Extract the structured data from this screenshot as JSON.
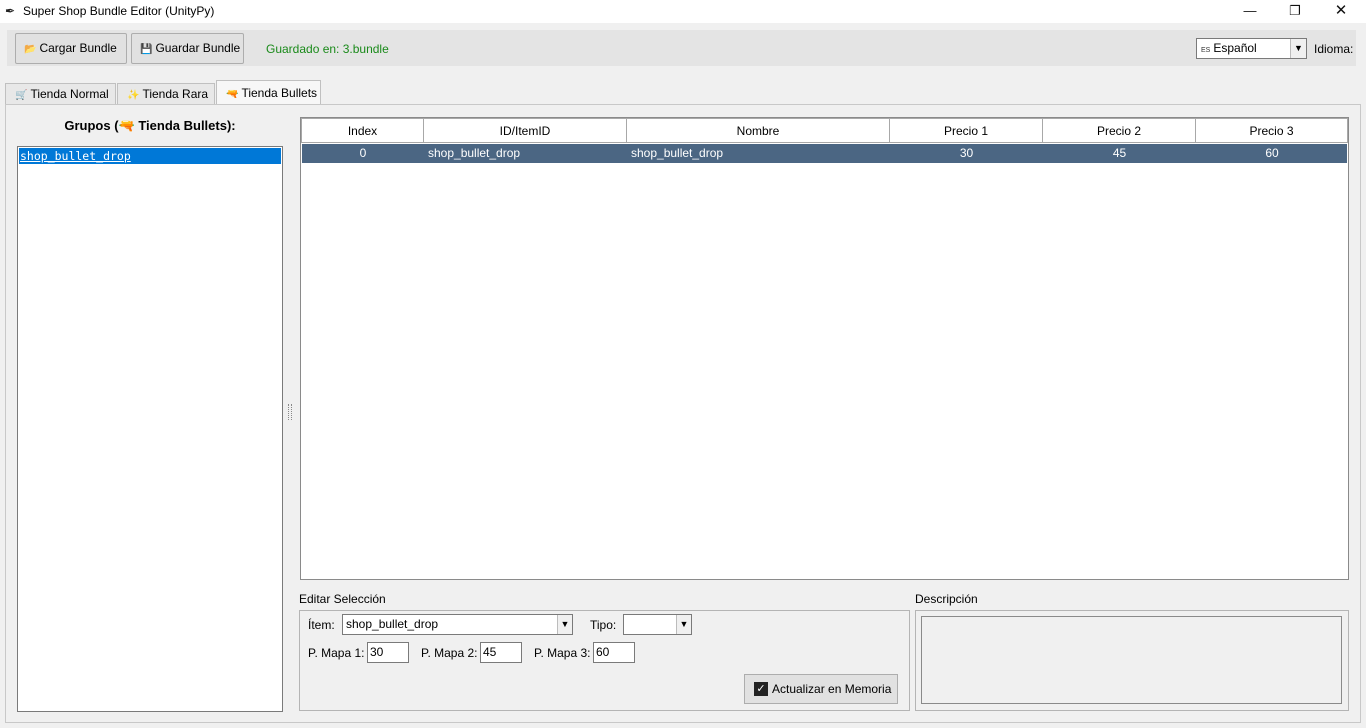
{
  "window": {
    "title": "Super Shop Bundle Editor (UnityPy)",
    "minimize_glyph": "—",
    "maximize_glyph": "❐",
    "close_glyph": "✕"
  },
  "toolbar": {
    "load_label": "Cargar Bundle",
    "save_label": "Guardar Bundle",
    "saved_status": "Guardado en: 3.bundle",
    "language_value": "Español",
    "language_flag": "ES",
    "language_label": "Idioma:"
  },
  "tabs": [
    {
      "label": "Tienda Normal",
      "icon": "cart-icon",
      "glyph": "🛒",
      "active": false
    },
    {
      "label": "Tienda Rara",
      "icon": "sparkle-icon",
      "glyph": "✨",
      "active": false
    },
    {
      "label": "Tienda Bullets",
      "icon": "gun-icon",
      "glyph": "🔫",
      "active": true
    }
  ],
  "groups": {
    "title": "Grupos (🔫 Tienda Bullets):",
    "items": [
      "shop_bullet_drop"
    ]
  },
  "table": {
    "columns": [
      "Index",
      "ID/ItemID",
      "Nombre",
      "Precio 1",
      "Precio 2",
      "Precio 3"
    ],
    "rows": [
      [
        "0",
        "shop_bullet_drop",
        "shop_bullet_drop",
        "30",
        "45",
        "60"
      ]
    ]
  },
  "edit": {
    "section_label": "Editar Selección",
    "item_label": "Ítem:",
    "item_value": "shop_bullet_drop",
    "type_label": "Tipo:",
    "type_value": "",
    "price1_label": "P. Mapa 1:",
    "price1_value": "30",
    "price2_label": "P. Mapa 2:",
    "price2_value": "45",
    "price3_label": "P. Mapa 3:",
    "price3_value": "60",
    "update_label": "Actualizar en Memoria",
    "update_checked": true
  },
  "description": {
    "section_label": "Descripción",
    "text": ""
  },
  "colors": {
    "selection": "#0078d7",
    "selected_row": "#4b6683",
    "status_green": "#1a8a1a"
  }
}
